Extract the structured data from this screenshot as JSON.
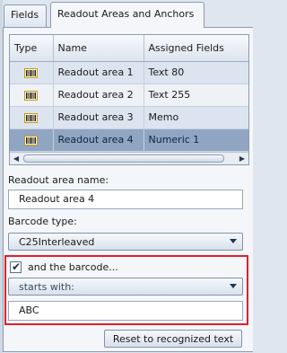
{
  "tabs": [
    {
      "label": "Fields",
      "active": false
    },
    {
      "label": "Readout Areas and Anchors",
      "active": true
    }
  ],
  "grid": {
    "columns": [
      "Type",
      "Name",
      "Assigned Fields"
    ],
    "rows": [
      {
        "type_icon": "barcode-icon",
        "name": "Readout area 1",
        "field": "Text 80"
      },
      {
        "type_icon": "barcode-icon",
        "name": "Readout area 2",
        "field": "Text 255"
      },
      {
        "type_icon": "barcode-icon",
        "name": "Readout area 3",
        "field": "Memo"
      },
      {
        "type_icon": "barcode-icon",
        "name": "Readout area 4",
        "field": "Numeric 1",
        "selected": true
      }
    ]
  },
  "readout_name": {
    "label": "Readout area name:",
    "value": "Readout area 4"
  },
  "barcode_type": {
    "label": "Barcode type:",
    "value": "C25Interleaved"
  },
  "barcode_condition": {
    "checkbox_label": "and the barcode...",
    "checked": true,
    "operator": "starts with:",
    "value": "ABC"
  },
  "reset_button": "Reset to recognized text",
  "colors": {
    "selection": "#8fa5c2",
    "highlight_border": "#e0202a",
    "icon_gold": "#c89a1c"
  }
}
